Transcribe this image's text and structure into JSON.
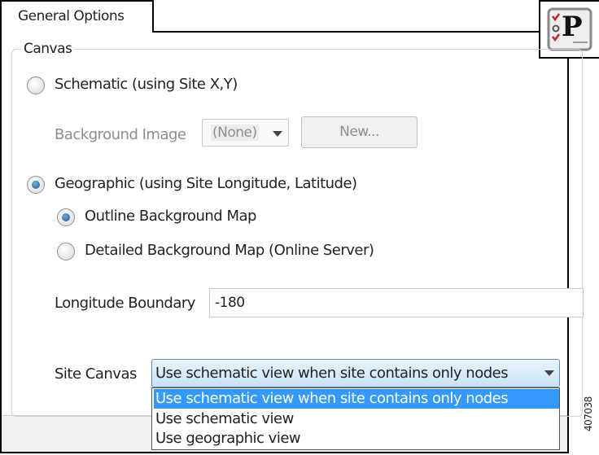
{
  "tab": {
    "label": "General Options"
  },
  "icon": {
    "name": "preferences-icon",
    "letter": "P"
  },
  "group": {
    "label": "Canvas"
  },
  "schematic": {
    "label": "Schematic (using Site X,Y)",
    "selected": false
  },
  "background_image": {
    "label": "Background Image",
    "value": "(None)",
    "new_button": "New..."
  },
  "geographic": {
    "label": "Geographic (using Site Longitude, Latitude)",
    "selected": true
  },
  "outline_map": {
    "label": "Outline Background Map",
    "selected": true
  },
  "detailed_map": {
    "label": "Detailed Background Map (Online Server)",
    "selected": false
  },
  "longitude": {
    "label": "Longitude Boundary",
    "value": "-180"
  },
  "site_canvas": {
    "label": "Site Canvas",
    "value": "Use schematic view when site contains only nodes",
    "options": [
      "Use schematic view when site contains only nodes",
      "Use schematic view",
      "Use geographic view"
    ]
  },
  "figure_id": "407038"
}
